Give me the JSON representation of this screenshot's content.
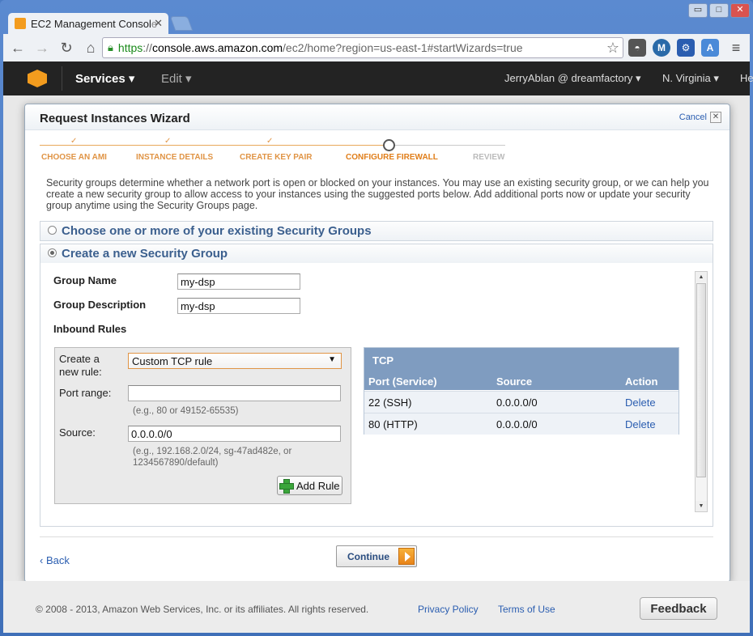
{
  "browser": {
    "tab_title": "EC2 Management Console",
    "tab_title_visible": "EC2 Management Consol",
    "tab_title_fade": "e",
    "tab_close": "✕",
    "window_controls": [
      "▭",
      "□",
      "✕"
    ],
    "url_scheme": "https",
    "url_sep": "://",
    "url_host": "console.aws.amazon.com",
    "url_path": "/ec2/home?region=us-east-1#startWizards=true",
    "icons": [
      "back-arrow-icon",
      "forward-arrow-icon",
      "reload-icon",
      "home-icon",
      "lock-icon",
      "star-icon",
      "menu-icon"
    ],
    "extensions": {
      "m": "M",
      "translate": "A"
    }
  },
  "aws_nav": {
    "services": "Services",
    "edit": "Edit",
    "user": "JerryAblan @ dreamfactory",
    "region": "N. Virginia",
    "help": "He",
    "chevron": "▾"
  },
  "wizard": {
    "title": "Request Instances Wizard",
    "cancel": "Cancel",
    "cancel_x": "✕",
    "steps": [
      {
        "label": "CHOOSE AN AMI",
        "state": "done",
        "mark": "✓"
      },
      {
        "label": "INSTANCE DETAILS",
        "state": "done",
        "mark": "✓"
      },
      {
        "label": "CREATE KEY PAIR",
        "state": "done",
        "mark": "✓"
      },
      {
        "label": "CONFIGURE FIREWALL",
        "state": "current"
      },
      {
        "label": "REVIEW",
        "state": "future"
      }
    ],
    "intro": "Security groups determine whether a network port is open or blocked on your instances. You may use an existing security group, or we can help you create a new security group to allow access to your instances using the suggested ports below. Add additional ports now or update your security group anytime using the Security Groups page.",
    "option_existing": "Choose one or more of your existing Security Groups",
    "option_new": "Create a new Security Group",
    "selected_option": "new",
    "group_name_label": "Group Name",
    "group_name_value": "my-dsp",
    "group_desc_label": "Group Description",
    "group_desc_value": "my-dsp",
    "inbound_label": "Inbound Rules",
    "new_rule": {
      "create_label": "Create a new rule:",
      "create_value": "Custom TCP rule",
      "select_arrow": "▼",
      "port_label": "Port range:",
      "port_value": "",
      "port_hint": "(e.g., 80 or 49152-65535)",
      "source_label": "Source:",
      "source_value": "0.0.0.0/0",
      "source_hint": "(e.g., 192.168.2.0/24, sg-47ad482e, or 1234567890/default)",
      "add_button": "Add Rule"
    },
    "rules_table": {
      "protocol": "TCP",
      "columns": [
        "Port (Service)",
        "Source",
        "Action"
      ],
      "rows": [
        {
          "port": "22 (SSH)",
          "source": "0.0.0.0/0",
          "action": "Delete"
        },
        {
          "port": "80 (HTTP)",
          "source": "0.0.0.0/0",
          "action": "Delete"
        }
      ]
    },
    "scroll_up": "▲",
    "scroll_down": "▼",
    "back": "‹  Back",
    "continue": "Continue"
  },
  "footer": {
    "copyright": "© 2008 - 2013, Amazon Web Services, Inc. or its affiliates. All rights reserved.",
    "privacy": "Privacy Policy",
    "terms": "Terms of Use",
    "feedback": "Feedback"
  },
  "colors": {
    "accent_orange": "#e09445",
    "link_blue": "#2a5db0",
    "header_blue": "#7f9cc0",
    "aws_bar": "#232323"
  }
}
